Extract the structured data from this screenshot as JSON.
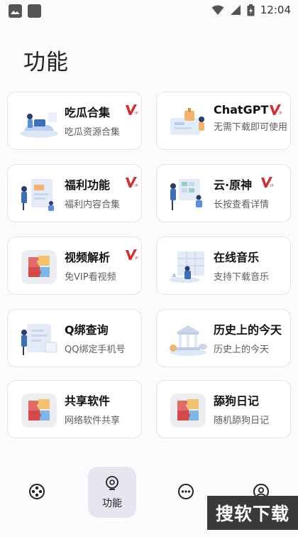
{
  "status_bar": {
    "time": "12:04"
  },
  "page": {
    "title": "功能"
  },
  "cards": [
    {
      "title": "吃瓜合集",
      "subtitle": "吃瓜资源合集",
      "vip": true
    },
    {
      "title": "ChatGPT",
      "subtitle": "无需下载即可使用",
      "vip": true
    },
    {
      "title": "福利功能",
      "subtitle": "福利内容合集",
      "vip": true
    },
    {
      "title": "云·原神",
      "subtitle": "长按查看详情",
      "vip": true
    },
    {
      "title": "视频解析",
      "subtitle": "免VIP看视频",
      "vip": true
    },
    {
      "title": "在线音乐",
      "subtitle": "支持下载音乐",
      "vip": false
    },
    {
      "title": "Q绑查询",
      "subtitle": "QQ绑定手机号",
      "vip": false
    },
    {
      "title": "历史上的今天",
      "subtitle": "历史上的今天",
      "vip": false
    },
    {
      "title": "共享软件",
      "subtitle": "网络软件共享",
      "vip": false
    },
    {
      "title": "舔狗日记",
      "subtitle": "随机舔狗日记",
      "vip": false
    }
  ],
  "tabbar": {
    "items": [
      {
        "icon": "film-reel-icon"
      },
      {
        "icon": "bulb-icon",
        "label": "功能",
        "active": true
      },
      {
        "icon": "more-icon"
      },
      {
        "icon": "user-icon"
      }
    ]
  },
  "watermark": {
    "text": "搜软下载"
  },
  "colors": {
    "accent": "#d32f2f",
    "card_border": "#e4e4ea",
    "active_tab_bg": "#e6e6f0"
  }
}
